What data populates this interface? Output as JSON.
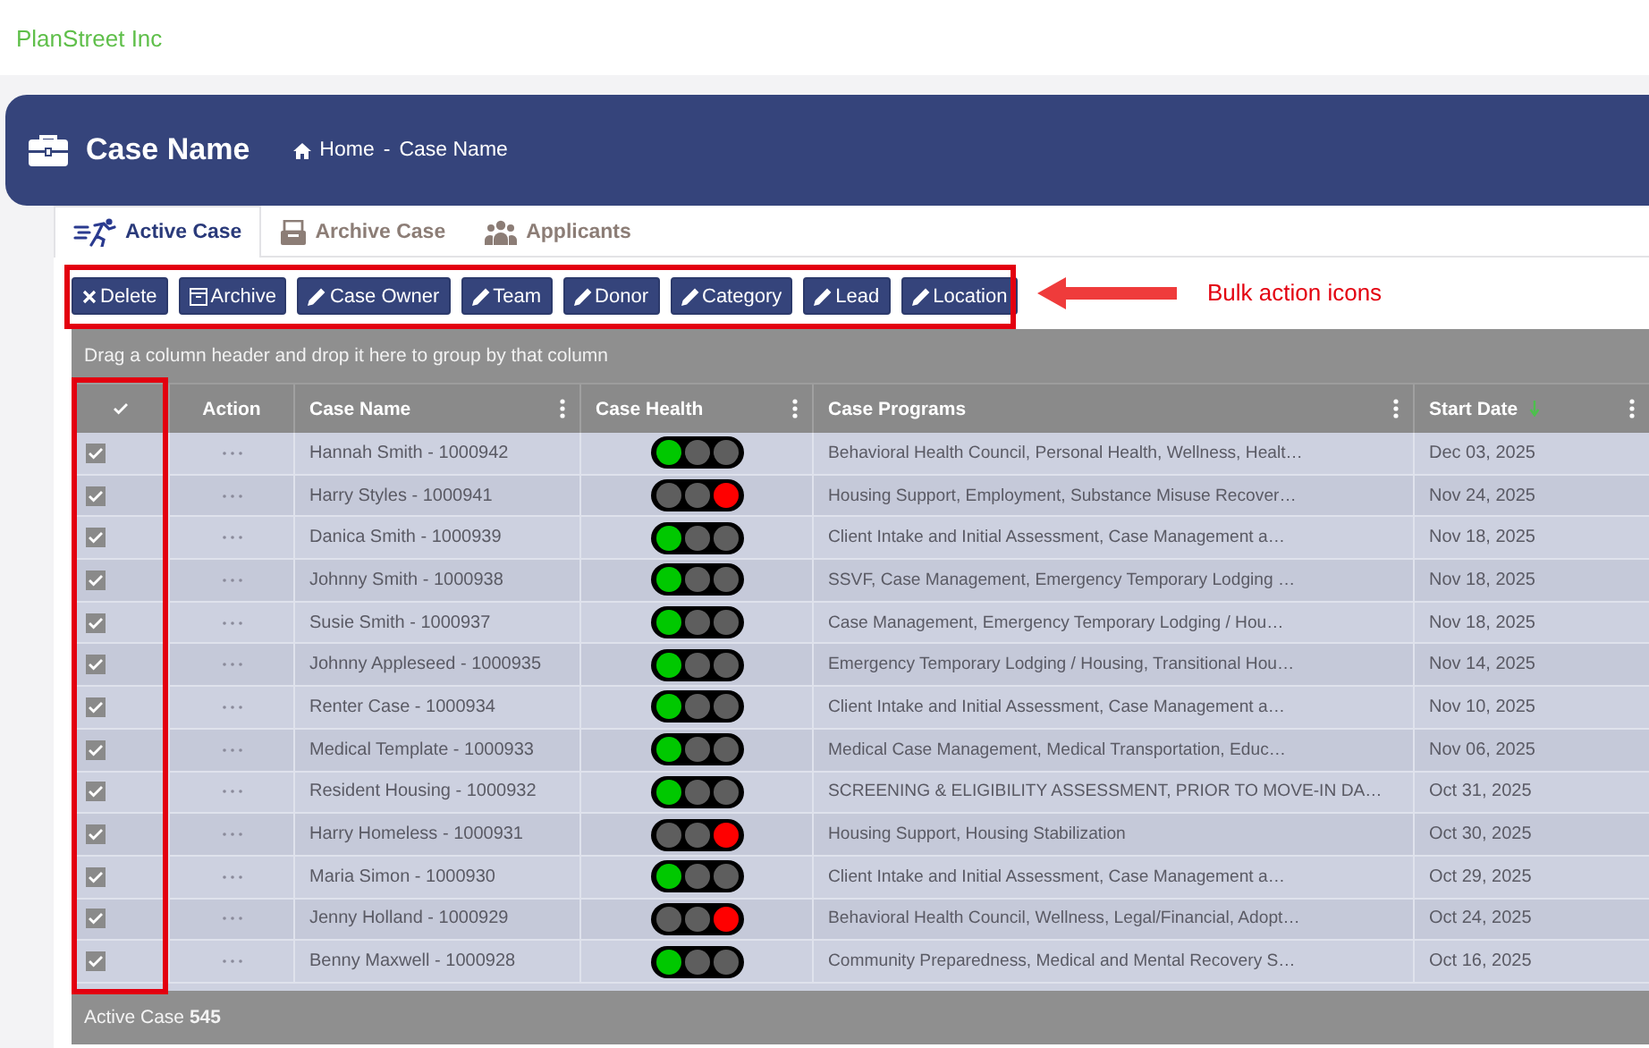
{
  "brand": "PlanStreet Inc",
  "header": {
    "title": "Case Name",
    "breadcrumb": [
      "Home",
      "Case Name"
    ],
    "separator": "-"
  },
  "tabs": [
    {
      "label": "Active Case",
      "kind": "runner",
      "selected": true
    },
    {
      "label": "Archive Case",
      "kind": "archive",
      "selected": false
    },
    {
      "label": "Applicants",
      "kind": "people",
      "selected": false
    }
  ],
  "toolbar": [
    {
      "label": "Delete",
      "kind": "delete"
    },
    {
      "label": "Archive",
      "kind": "archive"
    },
    {
      "label": "Case Owner",
      "kind": "edit"
    },
    {
      "label": "Team",
      "kind": "edit"
    },
    {
      "label": "Donor",
      "kind": "edit"
    },
    {
      "label": "Category",
      "kind": "edit"
    },
    {
      "label": "Lead",
      "kind": "edit"
    },
    {
      "label": "Location",
      "kind": "edit"
    }
  ],
  "grid": {
    "group_hint": "Drag a column header and drop it here to group by that column",
    "select_all": {
      "checked": true
    },
    "columns": [
      {
        "label": "Action",
        "menu": false,
        "sorted": false
      },
      {
        "label": "Case Name",
        "menu": true,
        "sorted": false
      },
      {
        "label": "Case Health",
        "menu": true,
        "sorted": false
      },
      {
        "label": "Case Programs",
        "menu": true,
        "sorted": false
      },
      {
        "label": "Start Date",
        "menu": true,
        "sorted": true
      }
    ],
    "rows": [
      {
        "checked": true,
        "case_name": "Hannah Smith - 1000942",
        "color": "#00c800",
        "programs": "Behavioral Health Council, Personal Health, Wellness, Healt…",
        "start_date": "Dec 03, 2025"
      },
      {
        "checked": true,
        "case_name": "Harry Styles - 1000941",
        "color": "#ff0000",
        "programs": "Housing Support, Employment, Substance Misuse Recover…",
        "start_date": "Nov 24, 2025"
      },
      {
        "checked": true,
        "case_name": "Danica Smith - 1000939",
        "color": "#00c800",
        "programs": "Client Intake and Initial Assessment, Case Management a…",
        "start_date": "Nov 18, 2025"
      },
      {
        "checked": true,
        "case_name": "Johnny Smith - 1000938",
        "color": "#00c800",
        "programs": "SSVF, Case Management, Emergency Temporary Lodging …",
        "start_date": "Nov 18, 2025"
      },
      {
        "checked": true,
        "case_name": "Susie Smith - 1000937",
        "color": "#00c800",
        "programs": "Case Management, Emergency Temporary Lodging / Hou…",
        "start_date": "Nov 18, 2025"
      },
      {
        "checked": true,
        "case_name": "Johnny Appleseed - 1000935",
        "color": "#00c800",
        "programs": "Emergency Temporary Lodging / Housing, Transitional Hou…",
        "start_date": "Nov 14, 2025"
      },
      {
        "checked": true,
        "case_name": "Renter Case - 1000934",
        "color": "#00c800",
        "programs": "Client Intake and Initial Assessment, Case Management a…",
        "start_date": "Nov 10, 2025"
      },
      {
        "checked": true,
        "case_name": "Medical Template - 1000933",
        "color": "#00c800",
        "programs": "Medical Case Management, Medical Transportation, Educ…",
        "start_date": "Nov 06, 2025"
      },
      {
        "checked": true,
        "case_name": "Resident Housing - 1000932",
        "color": "#00c800",
        "programs": "SCREENING & ELIGIBILITY ASSESSMENT, PRIOR TO MOVE-IN DA…",
        "start_date": "Oct 31, 2025"
      },
      {
        "checked": true,
        "case_name": "Harry Homeless - 1000931",
        "color": "#ff0000",
        "programs": "Housing Support, Housing Stabilization",
        "start_date": "Oct 30, 2025"
      },
      {
        "checked": true,
        "case_name": "Maria Simon - 1000930",
        "color": "#00c800",
        "programs": "Client Intake and Initial Assessment, Case Management a…",
        "start_date": "Oct 29, 2025"
      },
      {
        "checked": true,
        "case_name": "Jenny Holland - 1000929",
        "color": "#ff0000",
        "programs": "Behavioral Health Council, Wellness, Legal/Financial, Adopt…",
        "start_date": "Oct 24, 2025"
      },
      {
        "checked": true,
        "case_name": "Benny Maxwell - 1000928",
        "color": "#00c800",
        "programs": "Community Preparedness, Medical and Mental Recovery S…",
        "start_date": "Oct 16, 2025"
      }
    ],
    "footer": "Active Case **545**"
  },
  "annotation": {
    "label": "Bulk action icons"
  }
}
